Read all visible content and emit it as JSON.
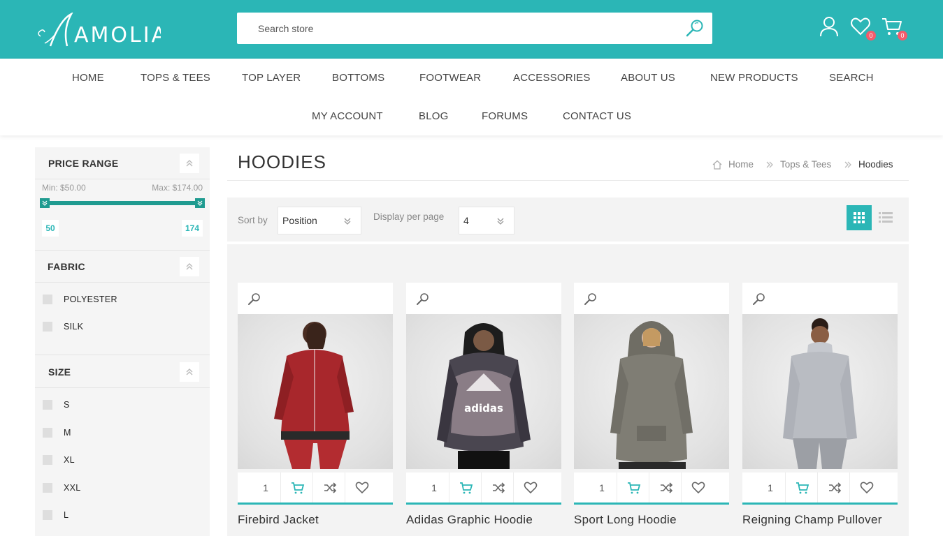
{
  "brand": {
    "logo_text": "AMOLIA",
    "accent": "#2bb6b6",
    "badge_color": "#f25c6c"
  },
  "search": {
    "placeholder": "Search store",
    "icon": "search-icon"
  },
  "header": {
    "account_icon": "user-icon",
    "wishlist": {
      "icon": "heart-icon",
      "count": "0"
    },
    "cart": {
      "icon": "cart-icon",
      "count": "0"
    }
  },
  "nav": {
    "items": [
      "HOME",
      "TOPS & TEES",
      "TOP LAYER",
      "BOTTOMS",
      "FOOTWEAR",
      "ACCESSORIES",
      "ABOUT US",
      "NEW PRODUCTS",
      "SEARCH",
      "MY ACCOUNT",
      "BLOG",
      "FORUMS",
      "CONTACT US"
    ]
  },
  "filters": {
    "price": {
      "title": "PRICE RANGE",
      "min_label": "Min: $50.00",
      "max_label": "Max: $174.00",
      "min_value": "50",
      "max_value": "174"
    },
    "fabric": {
      "title": "FABRIC",
      "options": [
        "POLYESTER",
        "SILK"
      ]
    },
    "size": {
      "title": "SIZE",
      "options": [
        "S",
        "M",
        "XL",
        "XXL",
        "L"
      ]
    }
  },
  "page": {
    "title": "HOODIES"
  },
  "breadcrumb": {
    "home": "Home",
    "parent": "Tops & Tees",
    "current": "Hoodies"
  },
  "toolbar": {
    "sort_label": "Sort by",
    "sort_value": "Position",
    "display_label": "Display per page",
    "display_value": "4",
    "view_grid_icon": "grid-view-icon",
    "view_list_icon": "list-view-icon"
  },
  "products": [
    {
      "name": "Firebird Jacket",
      "qty": "1",
      "color": "#a8272c"
    },
    {
      "name": "Adidas Graphic Hoodie",
      "qty": "1",
      "color": "#3a3a40"
    },
    {
      "name": "Sport Long Hoodie",
      "qty": "1",
      "color": "#7f7d74"
    },
    {
      "name": "Reigning Champ Pullover",
      "qty": "1",
      "color": "#b9bcc2"
    }
  ]
}
